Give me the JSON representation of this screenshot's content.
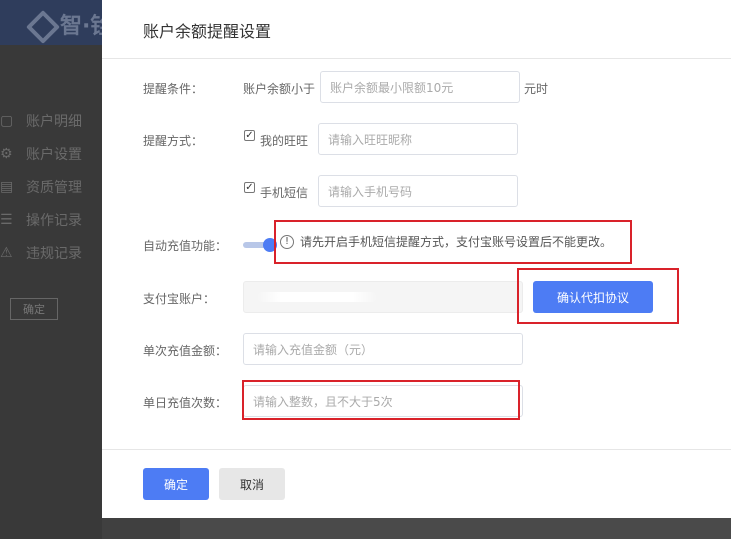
{
  "background": {
    "logo_text": "智·铨",
    "nav": [
      {
        "label": "账户明细",
        "icon": "wallet-icon"
      },
      {
        "label": "账户设置",
        "icon": "gear-icon"
      },
      {
        "label": "资质管理",
        "icon": "document-icon"
      },
      {
        "label": "操作记录",
        "icon": "list-icon"
      },
      {
        "label": "违规记录",
        "icon": "warning-icon"
      }
    ],
    "button_label": "确定"
  },
  "modal": {
    "title": "账户余额提醒设置",
    "condition": {
      "label": "提醒条件：",
      "prefix": "账户余额小于",
      "placeholder": "账户余额最小限额10元",
      "suffix": "元时"
    },
    "method": {
      "label": "提醒方式：",
      "wangwang": {
        "checked": true,
        "label": "我的旺旺",
        "placeholder": "请输入旺旺昵称"
      },
      "sms": {
        "checked": true,
        "label": "手机短信",
        "placeholder": "请输入手机号码"
      }
    },
    "auto_recharge": {
      "label": "自动充值功能：",
      "enabled": true,
      "notice": "请先开启手机短信提醒方式，支付宝账号设置后不能更改。"
    },
    "alipay": {
      "label": "支付宝账户：",
      "confirm_button": "确认代扣协议"
    },
    "single_amount": {
      "label": "单次充值金额：",
      "placeholder": "请输入充值金额（元）"
    },
    "daily_times": {
      "label": "单日充值次数：",
      "placeholder": "请输入整数，且不大于5次"
    },
    "footer": {
      "ok": "确定",
      "cancel": "取消"
    }
  },
  "colors": {
    "primary": "#4d7cf4",
    "highlight": "#d9222a"
  }
}
